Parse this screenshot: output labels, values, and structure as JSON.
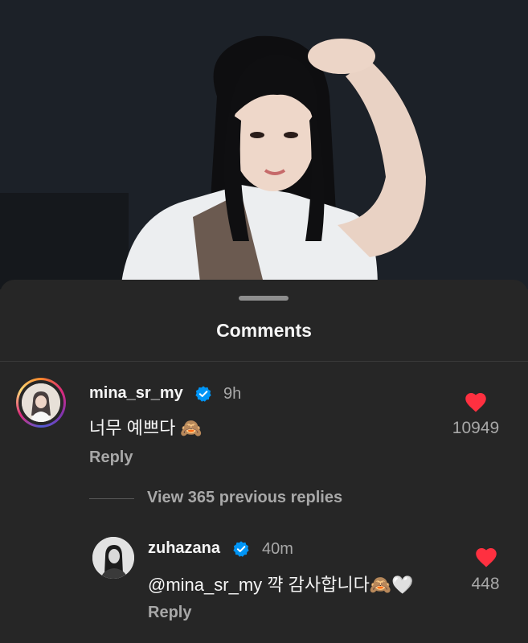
{
  "sheet": {
    "title": "Comments"
  },
  "comments": [
    {
      "username": "mina_sr_my",
      "verified": true,
      "time": "9h",
      "text": "너무 예쁘다 🙈",
      "likes": "10949",
      "reply_label": "Reply"
    }
  ],
  "view_replies": "View 365 previous replies",
  "replies": [
    {
      "username": "zuhazana",
      "verified": true,
      "time": "40m",
      "text": "@mina_sr_my 꺅 감사합니다🙈🤍",
      "likes": "448",
      "reply_label": "Reply"
    }
  ],
  "colors": {
    "background": "#262626",
    "verified": "#0095f6",
    "heart": "#ff3040",
    "secondary_text": "#a8a8a8"
  },
  "icons": [
    "verified-badge-icon",
    "heart-icon"
  ]
}
